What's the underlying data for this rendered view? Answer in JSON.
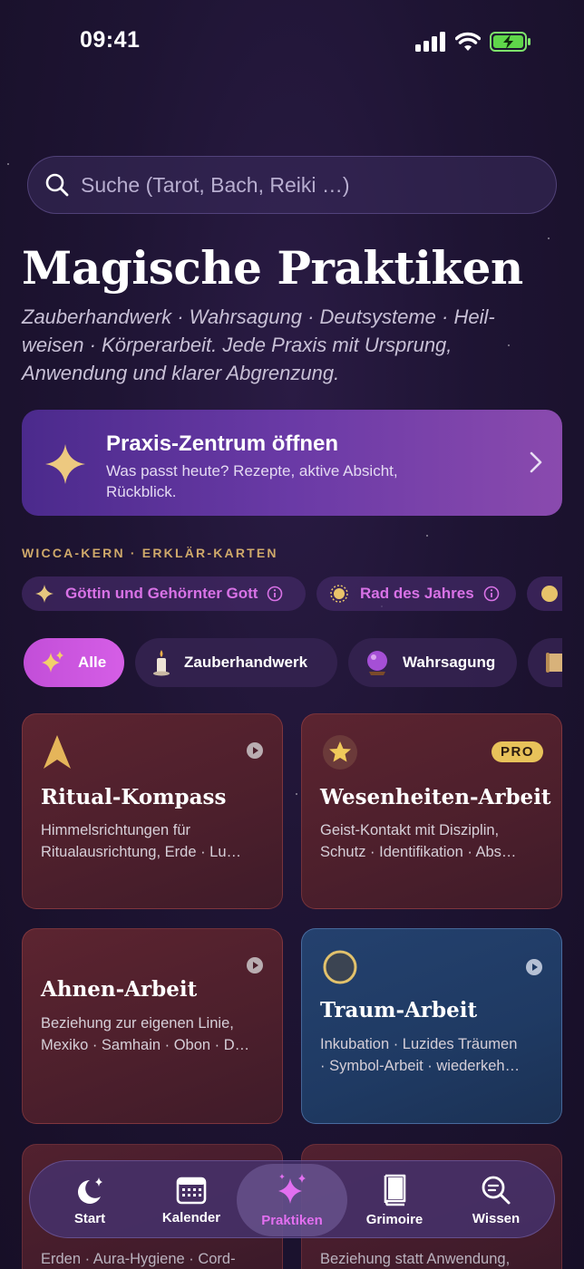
{
  "status": {
    "time": "09:41"
  },
  "search": {
    "placeholder": "Suche (Tarot, Bach, Reiki …)"
  },
  "page": {
    "title": "Magische Praktiken",
    "subtitle": "Zauberhandwerk · Wahrsagung · Deutsysteme · Heil-weisen · Körperarbeit. Jede Praxis mit Ursprung, Anwendung und klarer Abgrenzung."
  },
  "praxis": {
    "title": "Praxis-Zentrum öffnen",
    "description": "Was passt heute? Rezepte, aktive Absicht, Rückblick.",
    "icon": "sparkle-star-icon"
  },
  "wicca": {
    "label": "WICCA-KERN · ERKLÄR-KARTEN",
    "pills": [
      {
        "label": "Göttin und Gehörnter Gott",
        "icon": "sparkle-icon"
      },
      {
        "label": "Rad des Jahres",
        "icon": "sun-icon"
      },
      {
        "label": "",
        "icon": "moon-icon"
      }
    ]
  },
  "categories": [
    {
      "label": "Alle",
      "icon": "sparkles-icon",
      "active": true
    },
    {
      "label": "Zauberhandwerk",
      "icon": "candle-icon",
      "active": false
    },
    {
      "label": "Wahrsagung",
      "icon": "crystal-ball-icon",
      "active": false
    },
    {
      "label": "",
      "icon": "scroll-icon",
      "active": false
    }
  ],
  "cards": [
    {
      "title": "Ritual-Kompass",
      "description": "Himmelsrichtungen für\nRitualausrichtung, Erde · Lu…",
      "icon": "compass-arrow-icon",
      "badge": ""
    },
    {
      "title": "Wesenheiten-Arbeit",
      "description": "Geist-Kontakt mit Disziplin,\nSchutz · Identifikation · Abs…",
      "icon": "star-icon",
      "badge": "PRO"
    },
    {
      "title": "Ahnen-Arbeit",
      "description": "Beziehung zur eigenen Linie,\nMexiko · Samhain · Obon · D…",
      "icon": "",
      "badge": ""
    },
    {
      "title": "Traum-Arbeit",
      "description": "Inkubation · Luzides Träumen\n· Symbol-Arbeit · wiederkeh…",
      "icon": "moon-circle-icon",
      "badge": ""
    }
  ],
  "peek": {
    "left": "Erden · Aura-Hygiene · Cord-",
    "right": "Beziehung statt Anwendung,"
  },
  "tabs": [
    {
      "label": "Start",
      "icon": "moon-stars-icon"
    },
    {
      "label": "Kalender",
      "icon": "calendar-icon"
    },
    {
      "label": "Praktiken",
      "icon": "sparkles-icon"
    },
    {
      "label": "Grimoire",
      "icon": "book-icon"
    },
    {
      "label": "Wissen",
      "icon": "search-icon"
    }
  ],
  "colors": {
    "accent": "#d55ee6",
    "gold": "#e8c25a",
    "background": "#1e1433"
  }
}
